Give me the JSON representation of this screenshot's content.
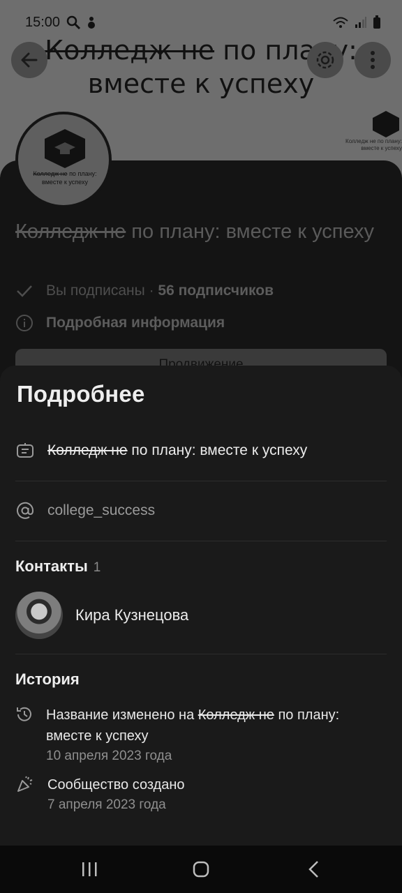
{
  "status_bar": {
    "time": "15:00"
  },
  "cover": {
    "title_struck": "Колледж не",
    "title_rest_line1": " по плану:",
    "title_line2": "вместе к успеху",
    "mini_logo_text": "Колледж не по плану: вместе к успеху"
  },
  "avatar_text": {
    "line1_struck": "Колледж не",
    "line1_rest": " по плану:",
    "line2": "вместе к успеху"
  },
  "community": {
    "name_struck": "Колледж не",
    "name_rest": " по плану: вместе к успеху",
    "subscribed_label": "Вы подписаны",
    "separator": " · ",
    "subscribers": "56 подписчиков",
    "details_link": "Подробная информация",
    "promo_button": "Продвижение"
  },
  "sheet": {
    "title": "Подробнее",
    "description_struck": "Колледж не",
    "description_rest": " по плану: вместе к успеху",
    "short_link": "college_success",
    "contacts_title": "Контакты",
    "contacts_count": "1",
    "contact_name": "Кира Кузнецова",
    "history_title": "История",
    "history": [
      {
        "text_prefix": "Название изменено на ",
        "text_struck": "Колледж не",
        "text_rest": " по плану: вместе к успеху",
        "date": "10 апреля 2023 года"
      },
      {
        "text": "Сообщество создано",
        "date": "7 апреля 2023 года"
      }
    ]
  }
}
